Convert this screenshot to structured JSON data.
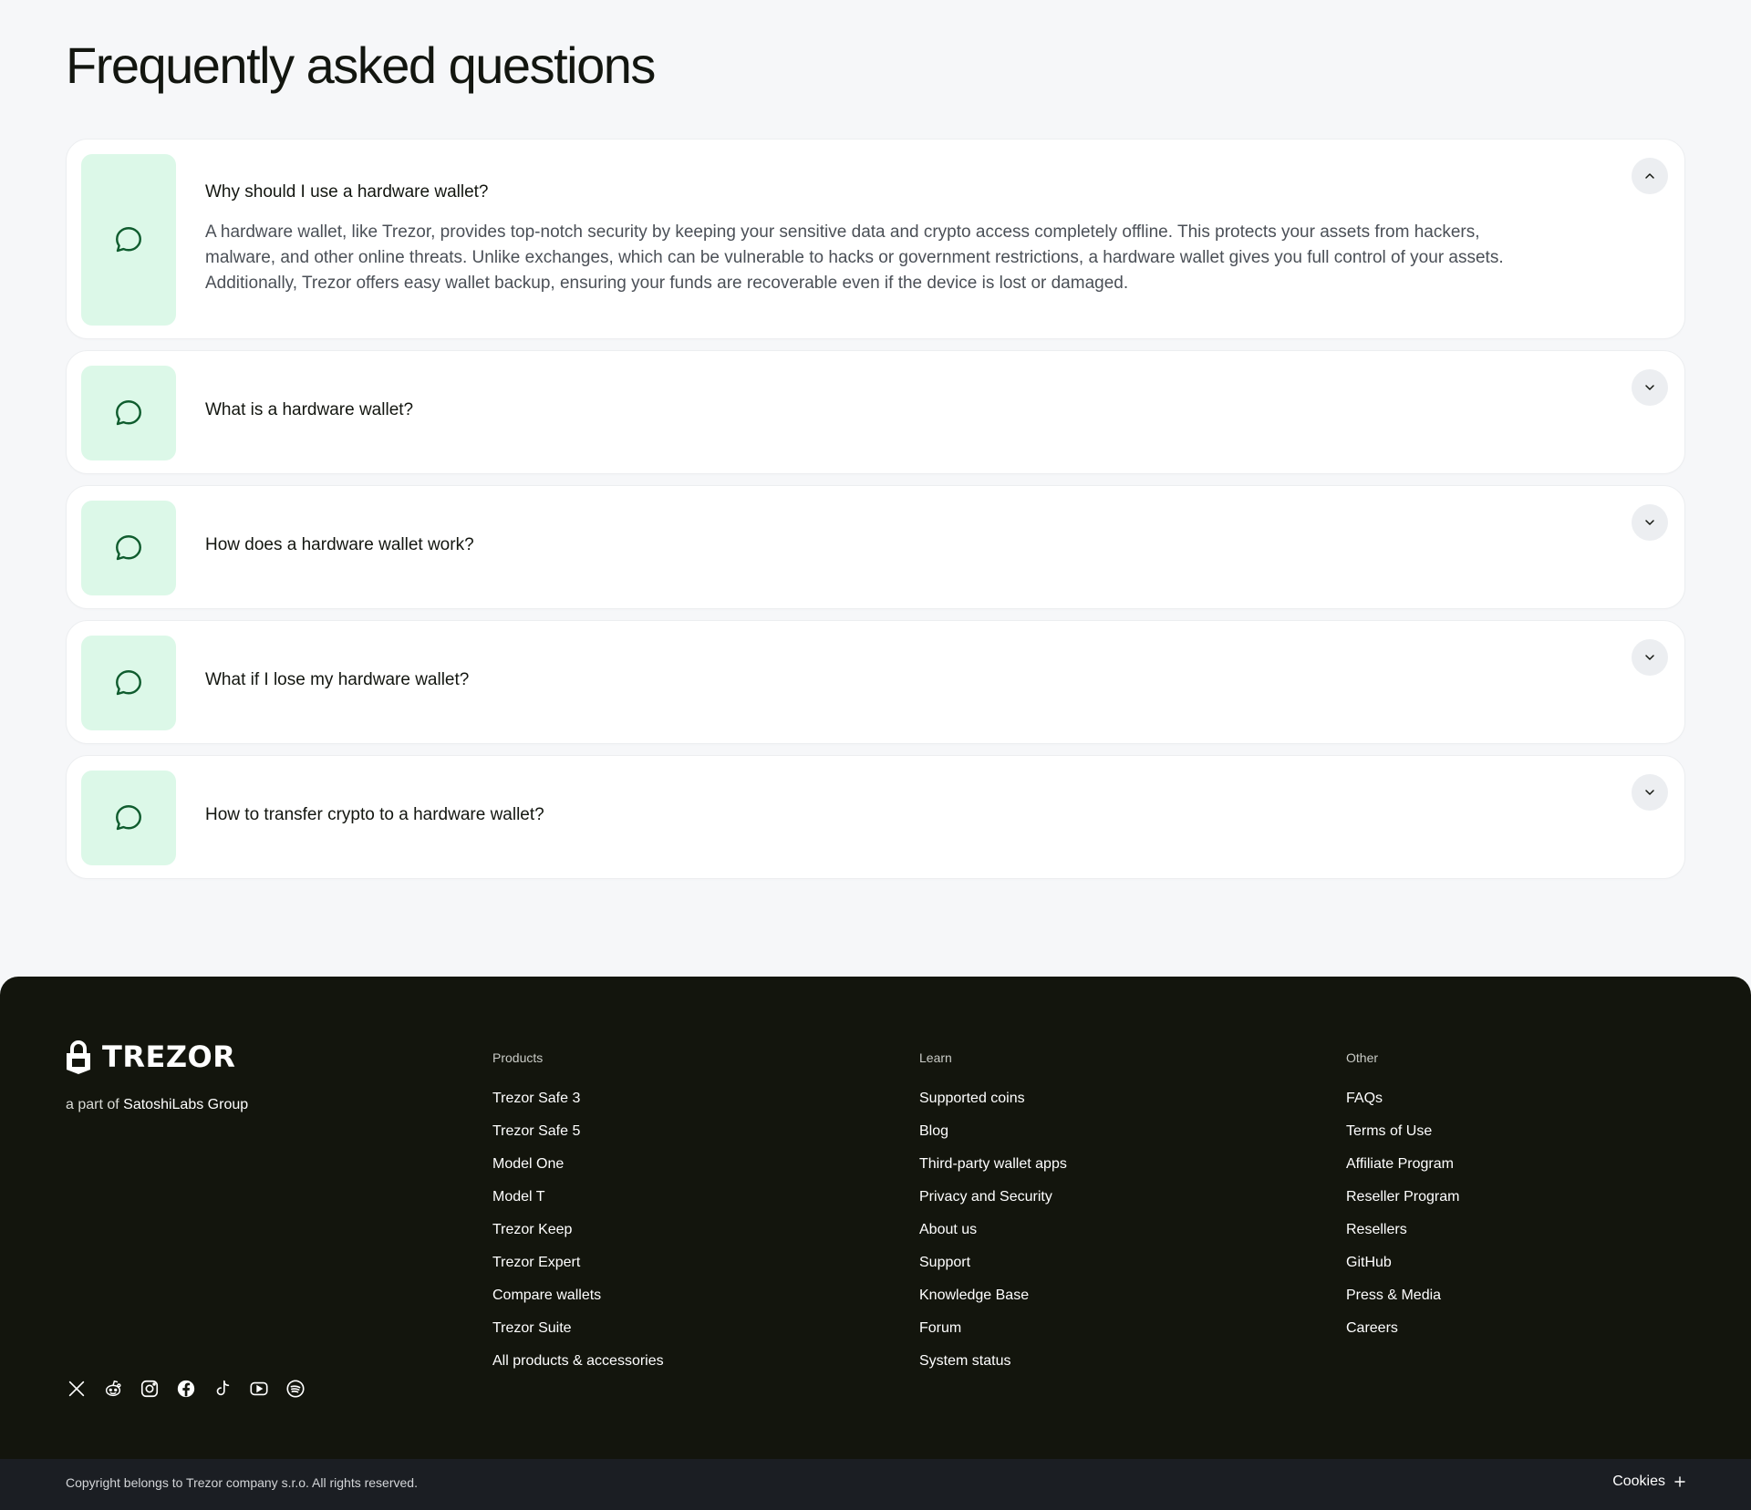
{
  "faq": {
    "title": "Frequently asked questions",
    "items": [
      {
        "question": "Why should I use a hardware wallet?",
        "answer": "A hardware wallet, like Trezor, provides top-notch security by keeping your sensitive data and crypto access completely offline. This protects your assets from hackers, malware, and other online threats. Unlike exchanges, which can be vulnerable to hacks or government restrictions, a hardware wallet gives you full control of your assets. Additionally, Trezor offers easy wallet backup, ensuring your funds are recoverable even if the device is lost or damaged.",
        "expanded": true
      },
      {
        "question": "What is a hardware wallet?",
        "expanded": false
      },
      {
        "question": "How does a hardware wallet work?",
        "expanded": false
      },
      {
        "question": "What if I lose my hardware wallet?",
        "expanded": false
      },
      {
        "question": "How to transfer crypto to a hardware wallet?",
        "expanded": false
      }
    ],
    "icon": "chat-bubble-icon",
    "icon_bg_color": "#dcf8e8",
    "icon_color": "#0f5c2e"
  },
  "footer": {
    "logo_text": "TREZOR",
    "tagline_prefix": "a part of",
    "tagline_brand": "SatoshiLabs Group",
    "columns": [
      {
        "title": "Products",
        "links": [
          "Trezor Safe 3",
          "Trezor Safe 5",
          "Model One",
          "Model T",
          "Trezor Keep",
          "Trezor Expert",
          "Compare wallets",
          "Trezor Suite",
          "All products & accessories"
        ]
      },
      {
        "title": "Learn",
        "links": [
          "Supported coins",
          "Blog",
          "Third-party wallet apps",
          "Privacy and Security",
          "About us",
          "Support",
          "Knowledge Base",
          "Forum",
          "System status"
        ]
      },
      {
        "title": "Other",
        "links": [
          "FAQs",
          "Terms of Use",
          "Affiliate Program",
          "Reseller Program",
          "Resellers",
          "GitHub",
          "Press & Media",
          "Careers"
        ]
      }
    ],
    "social": [
      "x-icon",
      "reddit-icon",
      "instagram-icon",
      "facebook-icon",
      "tiktok-icon",
      "youtube-icon",
      "spotify-icon"
    ],
    "background_color": "#13150d"
  },
  "bottom_bar": {
    "copyright": "Copyright belongs to Trezor company s.r.o. All rights reserved.",
    "cookies_label": "Cookies"
  }
}
